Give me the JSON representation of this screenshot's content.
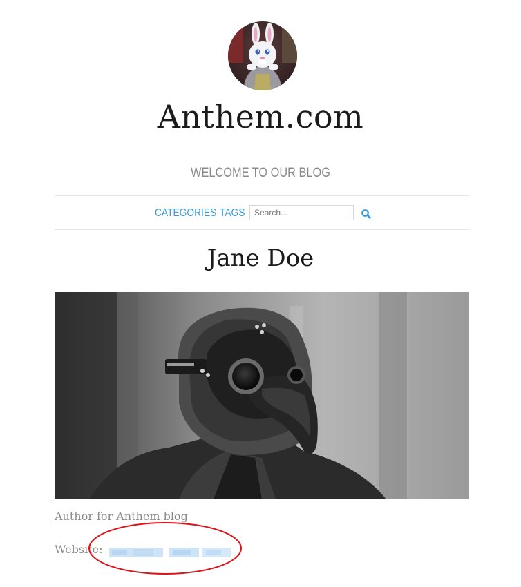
{
  "site": {
    "title": "Anthem.com",
    "tagline": "WELCOME TO OUR BLOG",
    "avatar_icon": "bunny-avatar"
  },
  "nav": {
    "categories_label": "CATEGORIES",
    "tags_label": "TAGS",
    "search_placeholder": "Search...",
    "search_icon": "search-icon"
  },
  "author": {
    "name": "Jane Doe",
    "cover_image": "plague-doctor-mask-photo",
    "bio": "Author for Anthem blog",
    "website_label": "Website:"
  },
  "colors": {
    "link": "#3a9ad9",
    "muted_text": "#8a8a8a",
    "heading": "#1b1b1b",
    "annotation": "#e0121a"
  }
}
